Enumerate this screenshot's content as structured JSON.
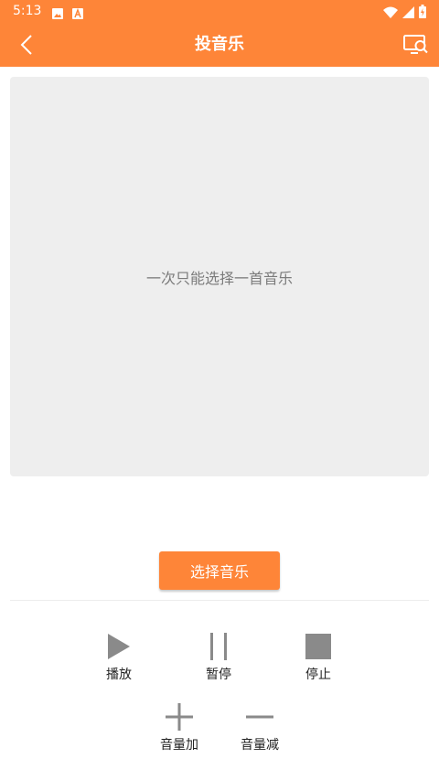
{
  "status_bar": {
    "time": "5:13"
  },
  "app_bar": {
    "title": "投音乐"
  },
  "preview": {
    "hint": "一次只能选择一首音乐"
  },
  "select_button": {
    "label": "选择音乐"
  },
  "controls": {
    "play": "播放",
    "pause": "暂停",
    "stop": "停止",
    "volume_up": "音量加",
    "volume_down": "音量减"
  },
  "colors": {
    "accent": "#fe8538",
    "icon_gray": "#8a8a8a",
    "preview_bg": "#eeeeee"
  },
  "icons": [
    "image-icon",
    "a-icon",
    "wifi-icon",
    "signal-icon",
    "battery-icon",
    "back-arrow-icon",
    "screen-search-icon",
    "play-icon",
    "pause-icon",
    "stop-icon",
    "plus-icon",
    "minus-icon"
  ]
}
